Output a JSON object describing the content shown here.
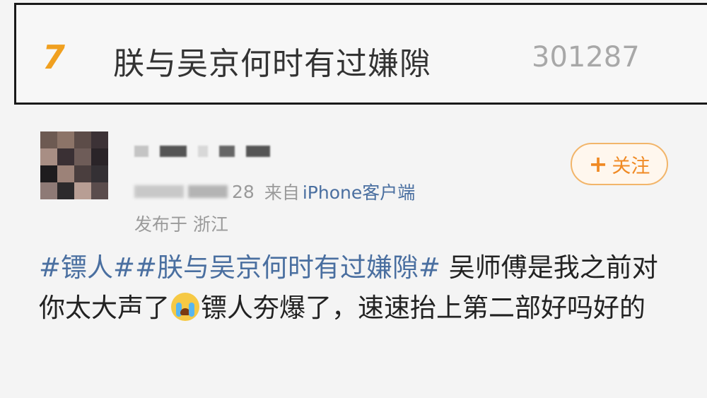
{
  "trend": {
    "rank": "7",
    "title": "朕与吴京何时有过嫌隙",
    "count": "301287"
  },
  "post": {
    "time_suffix": "28",
    "source_prefix": "来自",
    "device": "iPhone客户端",
    "location": "发布于 浙江",
    "follow_label": "关注",
    "follow_icon": "plus-icon",
    "tag1": "#镖人#",
    "tag2": "#朕与吴京何时有过嫌隙#",
    "text_line1": " 吴师傅是我之前对你太大声了",
    "emoji": "crying-face-emoji",
    "text_line2": "镖人夯爆了，速速抬上第二部好吗好的"
  },
  "colors": {
    "accent": "#f08a24",
    "link": "#4a6fa0",
    "rank": "#f0a020"
  }
}
